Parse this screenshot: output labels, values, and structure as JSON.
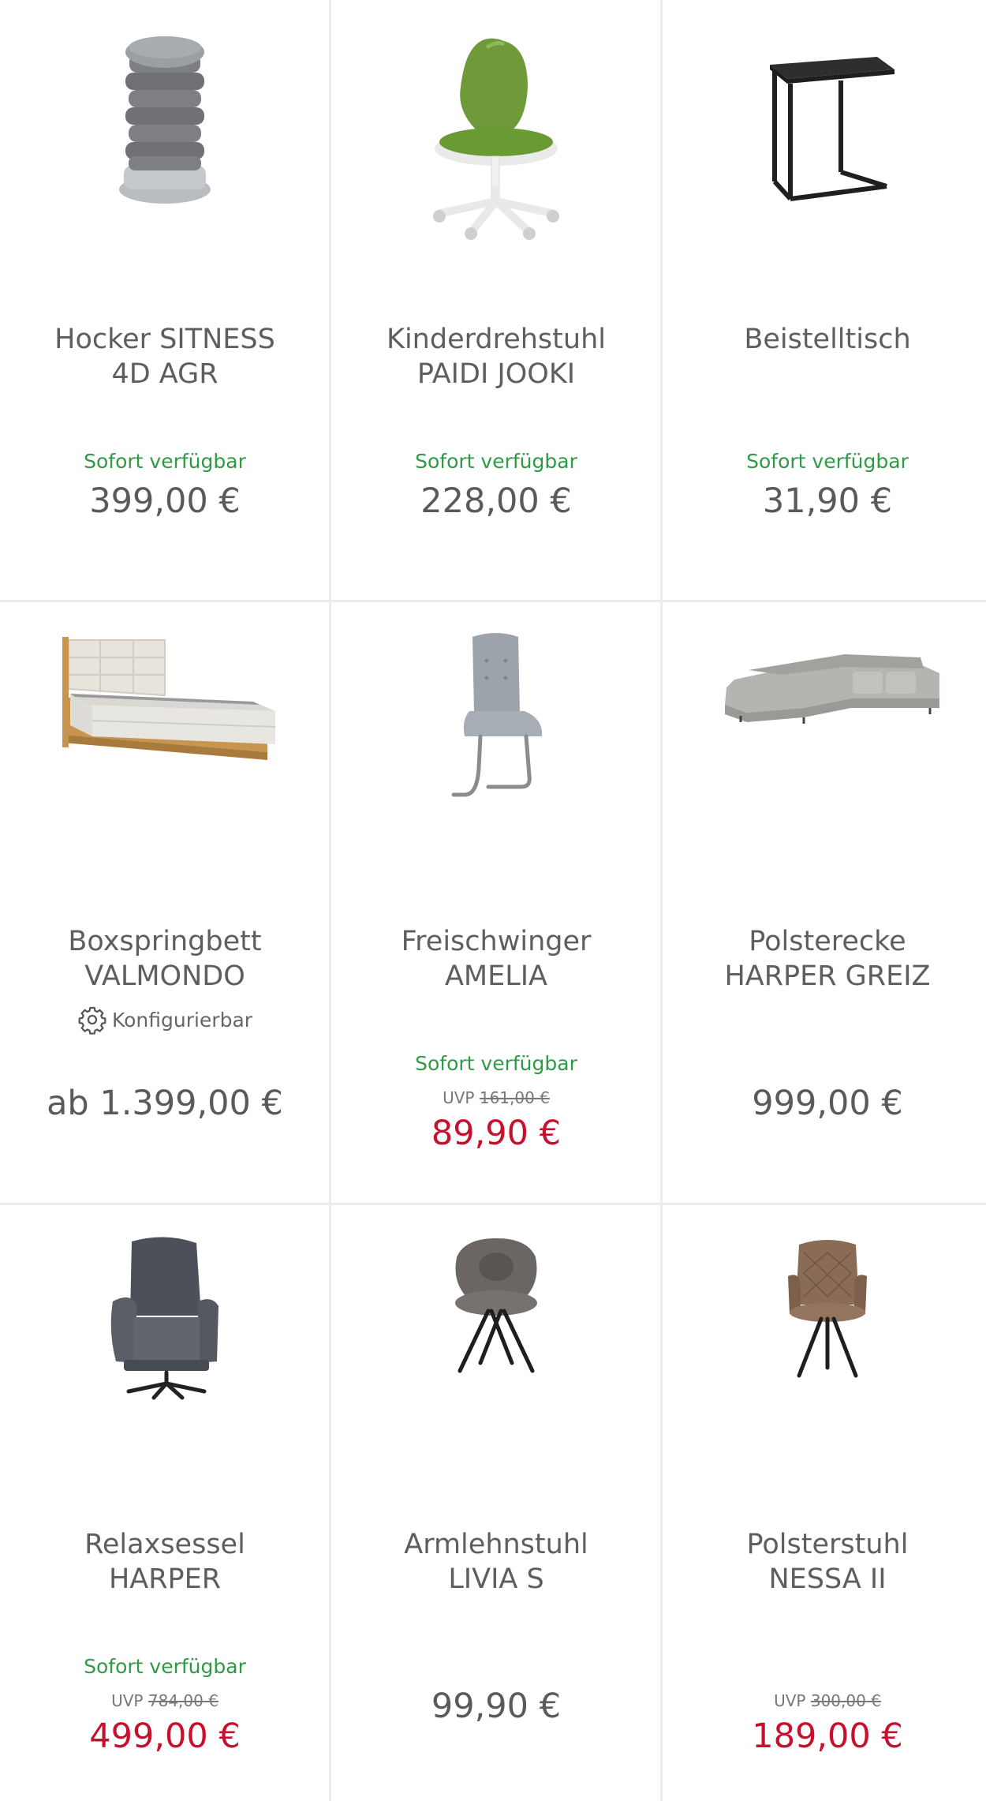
{
  "products": [
    {
      "title": "Hocker SITNESS\n4D AGR",
      "availability": "Sofort verfügbar",
      "price": "399,00 €",
      "image_icon": "stool-icon"
    },
    {
      "title": "Kinderdrehstuhl\nPAIDI JOOKI",
      "availability": "Sofort verfügbar",
      "price": "228,00 €",
      "image_icon": "kids-chair-icon"
    },
    {
      "title": "Beistelltisch",
      "availability": "Sofort verfügbar",
      "price": "31,90 €",
      "image_icon": "side-table-icon"
    },
    {
      "title": "Boxspringbett\nVALMONDO",
      "config_label": "Konfigurierbar",
      "price": "ab 1.399,00 €",
      "image_icon": "bed-icon"
    },
    {
      "title": "Freischwinger\nAMELIA",
      "availability": "Sofort verfügbar",
      "uvp_label": "UVP",
      "uvp_price": "161,00 €",
      "price": "89,90 €",
      "image_icon": "cantilever-chair-icon"
    },
    {
      "title": "Polsterecke\nHARPER GREIZ",
      "price": "999,00 €",
      "image_icon": "corner-sofa-icon"
    },
    {
      "title": "Relaxsessel\nHARPER",
      "availability": "Sofort verfügbar",
      "uvp_label": "UVP",
      "uvp_price": "784,00 €",
      "price": "499,00 €",
      "image_icon": "recliner-icon"
    },
    {
      "title": "Armlehnstuhl\nLIVIA S",
      "price": "99,90 €",
      "image_icon": "armchair-icon"
    },
    {
      "title": "Polsterstuhl\nNESSA II",
      "uvp_label": "UVP",
      "uvp_price": "300,00 €",
      "price": "189,00 €",
      "image_icon": "upholstered-chair-icon"
    }
  ],
  "colors": {
    "availability": "#2f9a46",
    "sale_price": "#c8102e",
    "price": "#5a5a5a",
    "divider": "#ececec"
  }
}
